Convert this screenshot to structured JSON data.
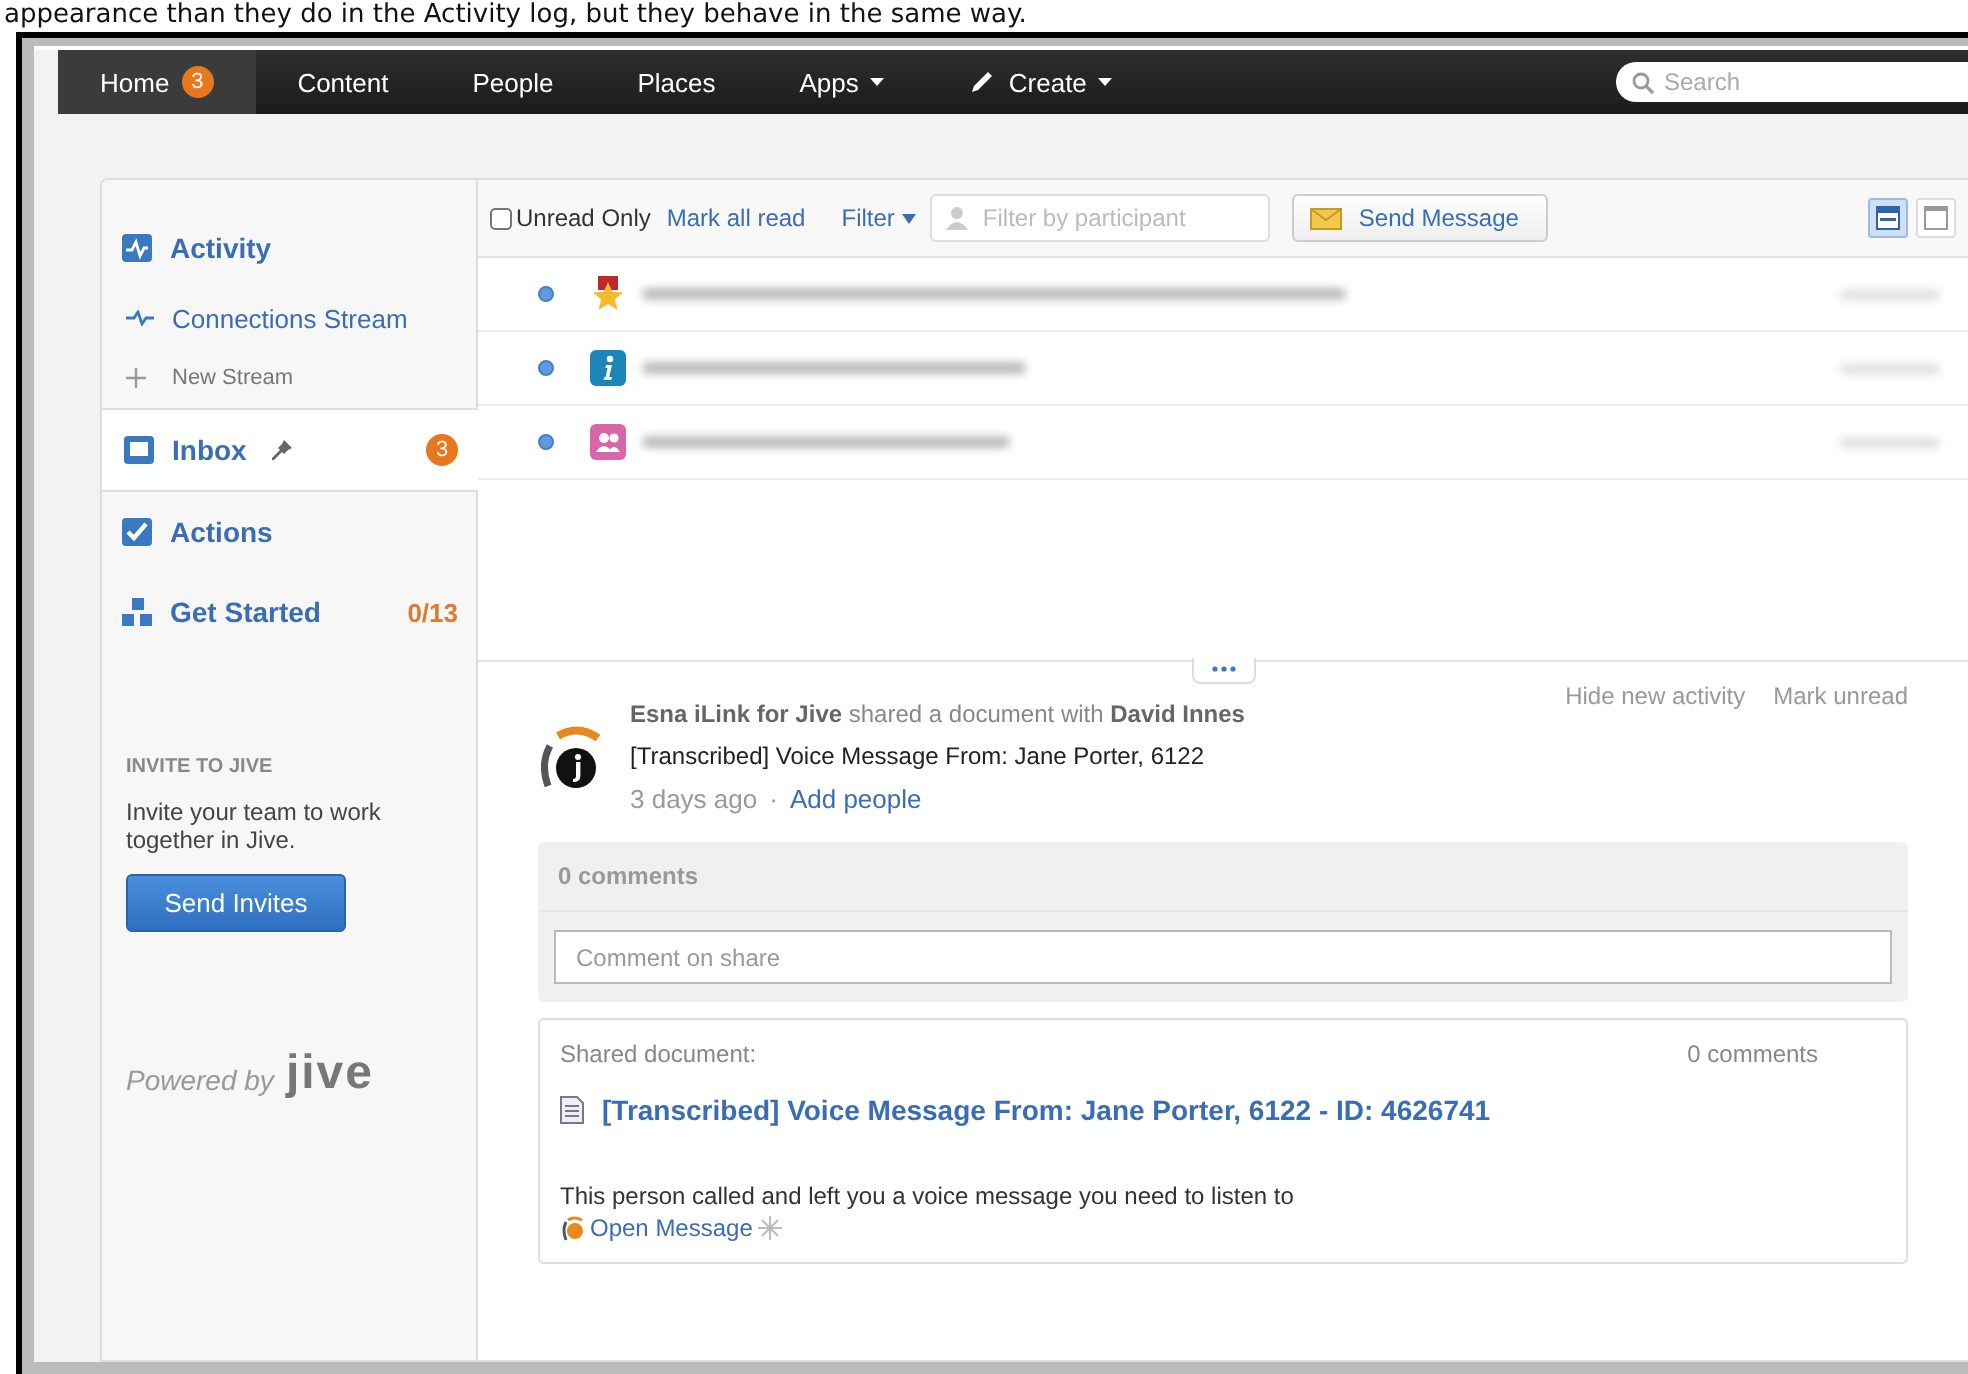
{
  "caption": "appearance than they do in the Activity log, but they behave in the same way.",
  "nav": {
    "items": [
      {
        "label": "Home",
        "kind": "link",
        "selected": true,
        "badge": "3"
      },
      {
        "label": "Content",
        "kind": "link",
        "selected": false
      },
      {
        "label": "People",
        "kind": "link",
        "selected": false
      },
      {
        "label": "Places",
        "kind": "link",
        "selected": false
      },
      {
        "label": "Apps",
        "kind": "menu",
        "selected": false
      },
      {
        "label": "Create",
        "kind": "create",
        "selected": false
      }
    ],
    "search": {
      "placeholder": "Search"
    }
  },
  "sidebar": {
    "items": [
      {
        "label": "Activity",
        "kind": "section",
        "selected": false
      },
      {
        "label": "Connections Stream",
        "kind": "stream",
        "selected": false
      },
      {
        "label": "New Stream",
        "kind": "add",
        "selected": false
      },
      {
        "label": "Inbox",
        "kind": "section",
        "selected": true,
        "pinned": true,
        "badge": "3"
      },
      {
        "label": "Actions",
        "kind": "section",
        "selected": false
      },
      {
        "label": "Get Started",
        "kind": "section",
        "selected": false,
        "count": "0/13"
      }
    ],
    "invite": {
      "heading": "INVITE TO JIVE",
      "text": "Invite your team to work together in Jive.",
      "button": "Send Invites"
    },
    "powered": {
      "label": "Powered by",
      "logo": "jive"
    }
  },
  "toolbar": {
    "unread_only": {
      "label": "Unread Only",
      "checked": false
    },
    "mark_all_read": "Mark all read",
    "filter": "Filter",
    "participant": {
      "placeholder": "Filter by participant"
    },
    "send_message": "Send Message",
    "views": [
      {
        "selected": true
      },
      {
        "selected": false
      }
    ]
  },
  "inbox": {
    "rows": [
      {
        "kind": "award",
        "unread": true
      },
      {
        "kind": "info",
        "unread": true
      },
      {
        "kind": "connection",
        "unread": true
      }
    ]
  },
  "detail": {
    "actions": [
      "Hide new activity",
      "Mark unread"
    ],
    "summary": "**Esna iLink for Jive** shared a document with **David Innes**",
    "title": "[Transcribed] Voice Message From: Jane Porter, 6122",
    "time": "3 days ago",
    "separator": "·",
    "add_people": "Add people",
    "comments": {
      "count": "0 comments",
      "placeholder": "Comment on share"
    },
    "shared": {
      "label": "Shared document:",
      "comments": "0 comments",
      "title": "[Transcribed] Voice Message From: Jane Porter, 6122  - ID: 4626741",
      "body": "This person called and left you a voice message you need to listen to",
      "link": "Open Message"
    }
  }
}
